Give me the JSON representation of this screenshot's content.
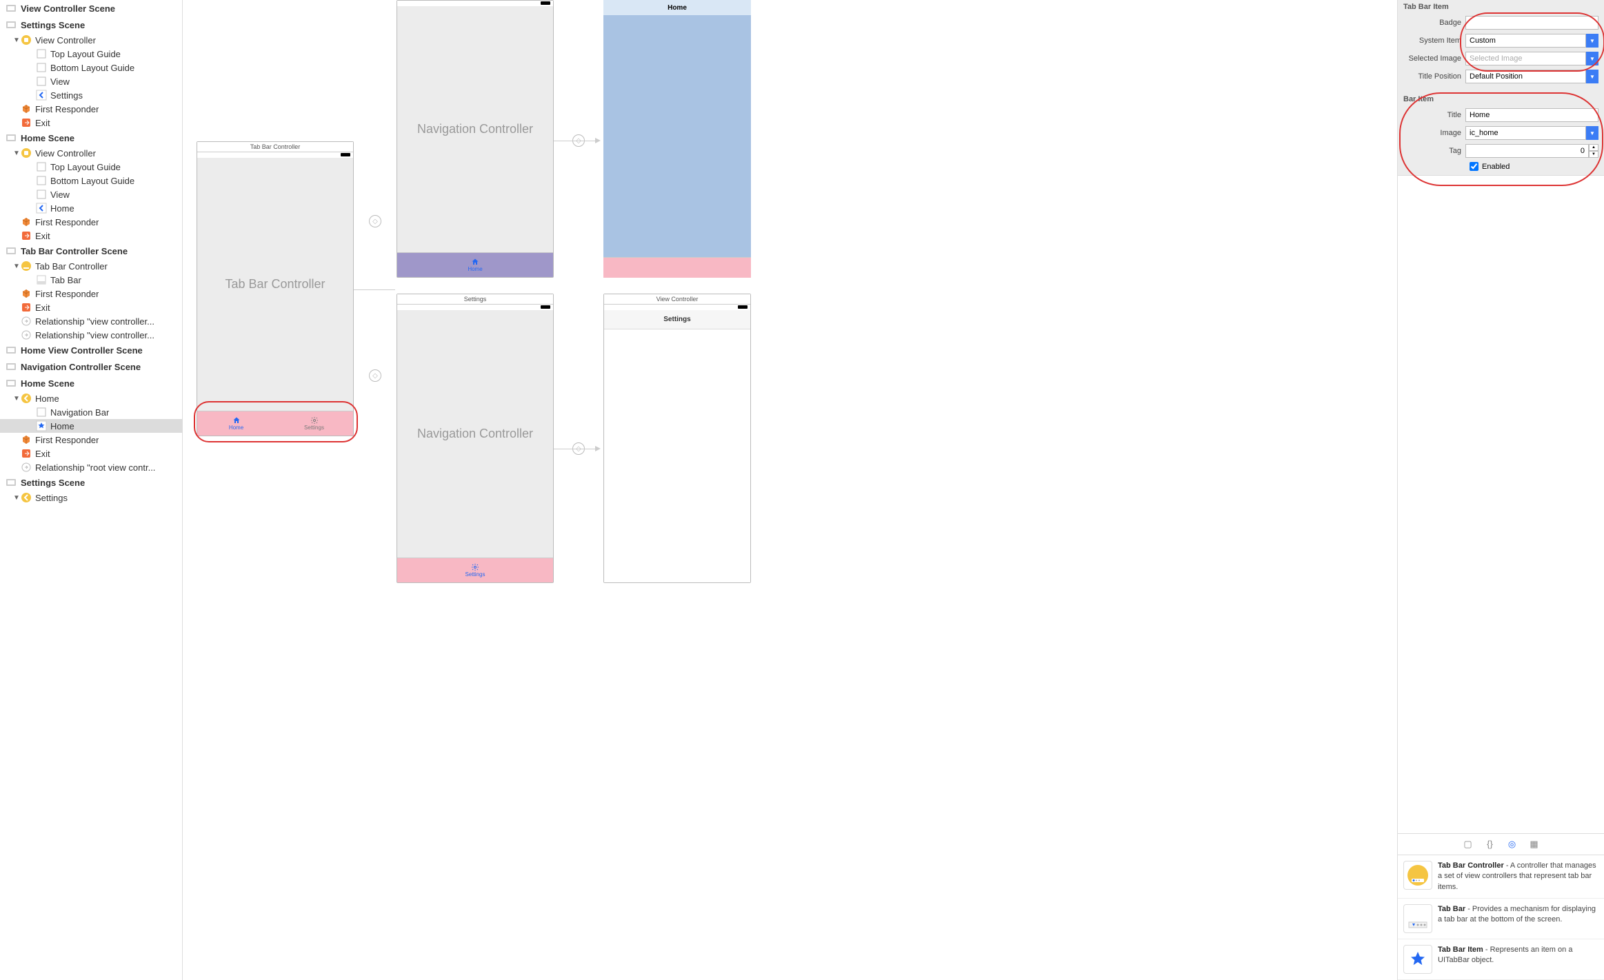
{
  "outline": {
    "scenes": [
      {
        "title": "View Controller Scene",
        "items": []
      },
      {
        "title": "Settings Scene",
        "items": [
          {
            "indent": 1,
            "disclosure": "▼",
            "icon": "vc",
            "label": "View Controller"
          },
          {
            "indent": 2,
            "disclosure": "",
            "icon": "guide",
            "label": "Top Layout Guide"
          },
          {
            "indent": 2,
            "disclosure": "",
            "icon": "guide",
            "label": "Bottom Layout Guide"
          },
          {
            "indent": 2,
            "disclosure": "",
            "icon": "guide",
            "label": "View"
          },
          {
            "indent": 2,
            "disclosure": "",
            "icon": "back",
            "label": "Settings"
          },
          {
            "indent": 1,
            "disclosure": "",
            "icon": "cube",
            "label": "First Responder"
          },
          {
            "indent": 1,
            "disclosure": "",
            "icon": "exit",
            "label": "Exit"
          }
        ]
      },
      {
        "title": "Home Scene",
        "items": [
          {
            "indent": 1,
            "disclosure": "▼",
            "icon": "vc",
            "label": "View Controller"
          },
          {
            "indent": 2,
            "disclosure": "",
            "icon": "guide",
            "label": "Top Layout Guide"
          },
          {
            "indent": 2,
            "disclosure": "",
            "icon": "guide",
            "label": "Bottom Layout Guide"
          },
          {
            "indent": 2,
            "disclosure": "",
            "icon": "guide",
            "label": "View"
          },
          {
            "indent": 2,
            "disclosure": "",
            "icon": "back",
            "label": "Home"
          },
          {
            "indent": 1,
            "disclosure": "",
            "icon": "cube",
            "label": "First Responder"
          },
          {
            "indent": 1,
            "disclosure": "",
            "icon": "exit",
            "label": "Exit"
          }
        ]
      },
      {
        "title": "Tab Bar Controller Scene",
        "items": [
          {
            "indent": 1,
            "disclosure": "▼",
            "icon": "tabvc",
            "label": "Tab Bar Controller"
          },
          {
            "indent": 2,
            "disclosure": "",
            "icon": "tabbar",
            "label": "Tab Bar"
          },
          {
            "indent": 1,
            "disclosure": "",
            "icon": "cube",
            "label": "First Responder"
          },
          {
            "indent": 1,
            "disclosure": "",
            "icon": "exit",
            "label": "Exit"
          },
          {
            "indent": 1,
            "disclosure": "",
            "icon": "segue",
            "label": "Relationship \"view controller..."
          },
          {
            "indent": 1,
            "disclosure": "",
            "icon": "segue",
            "label": "Relationship \"view controller..."
          }
        ]
      },
      {
        "title": "Home View Controller Scene",
        "items": []
      },
      {
        "title": "Navigation Controller Scene",
        "items": []
      },
      {
        "title": "Home Scene",
        "items": [
          {
            "indent": 1,
            "disclosure": "▼",
            "icon": "navvc",
            "label": "Home"
          },
          {
            "indent": 2,
            "disclosure": "",
            "icon": "guide",
            "label": "Navigation Bar"
          },
          {
            "indent": 2,
            "disclosure": "",
            "icon": "star",
            "label": "Home",
            "selected": true
          },
          {
            "indent": 1,
            "disclosure": "",
            "icon": "cube",
            "label": "First Responder"
          },
          {
            "indent": 1,
            "disclosure": "",
            "icon": "exit",
            "label": "Exit"
          },
          {
            "indent": 1,
            "disclosure": "",
            "icon": "segue",
            "label": "Relationship \"root view contr..."
          }
        ]
      },
      {
        "title": "Settings Scene",
        "items": [
          {
            "indent": 1,
            "disclosure": "▼",
            "icon": "navvc",
            "label": "Settings"
          }
        ]
      }
    ]
  },
  "canvas": {
    "tabbar_controller": {
      "title": "Tab Bar Controller",
      "center_label": "Tab Bar Controller",
      "tabs": [
        {
          "label": "Home",
          "active": true,
          "icon": "home"
        },
        {
          "label": "Settings",
          "active": false,
          "icon": "gear"
        }
      ]
    },
    "nav1": {
      "center_label": "Navigation Controller",
      "tab_label": "Home",
      "tab_icon": "home"
    },
    "nav2": {
      "title": "Settings",
      "center_label": "Navigation Controller",
      "tab_label": "Settings",
      "tab_icon": "gear"
    },
    "home_vc": {
      "top_label": "Home"
    },
    "vc": {
      "title": "View Controller",
      "nav_label": "Settings"
    }
  },
  "inspector": {
    "section1_title": "Tab Bar Item",
    "badge_label": "Badge",
    "badge_value": "",
    "system_item_label": "System Item",
    "system_item_value": "Custom",
    "selected_image_label": "Selected Image",
    "selected_image_placeholder": "Selected Image",
    "title_position_label": "Title Position",
    "title_position_value": "Default Position",
    "section2_title": "Bar Item",
    "title_label": "Title",
    "title_value": "Home",
    "image_label": "Image",
    "image_value": "ic_home",
    "tag_label": "Tag",
    "tag_value": "0",
    "enabled_label": "Enabled",
    "enabled_checked": true
  },
  "library": {
    "items": [
      {
        "icon": "tabvc",
        "title": "Tab Bar Controller",
        "desc": " - A controller that manages a set of view controllers that represent tab bar items."
      },
      {
        "icon": "tabbar",
        "title": "Tab Bar",
        "desc": " - Provides a mechanism for displaying a tab bar at the bottom of the screen."
      },
      {
        "icon": "tabitem",
        "title": "Tab Bar Item",
        "desc": " - Represents an item on a UITabBar object."
      }
    ]
  }
}
